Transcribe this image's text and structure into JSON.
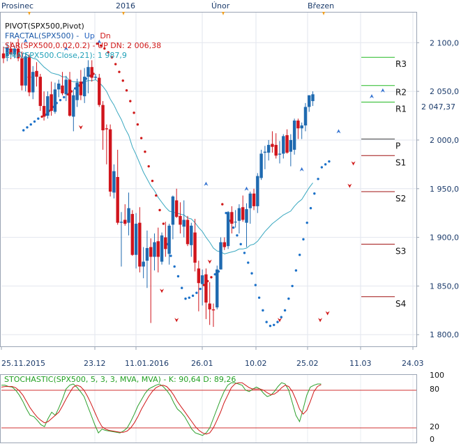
{
  "top_axis": {
    "labels": [
      "Prosinec",
      "2016",
      "Únor",
      "Březen"
    ],
    "marker_color": "#f0a020"
  },
  "legend": {
    "pivot": "PIVOT(SPX500,Pivot)",
    "fractal_prefix": "FRACTAL(SPX500) -",
    "fractal_up": "Up",
    "fractal_dn": "Dn",
    "sar": "SAR(SPX500,0.02,0.2) -  UP  DN: 2 006,38",
    "ema": "EMA(SPX500.Close,21): 1 987,9"
  },
  "price_panel": {
    "last_price_label": "2 047,37",
    "last_price": 2047.37
  },
  "stoch_legend": "STOCHASTIC(SPX500, 5, 3, 3, MVA, MVA) -  K: 90,64  D: 89,26",
  "colors": {
    "up_candle": "#1f6ab0",
    "down_candle": "#d0141c",
    "sar": "#d01818",
    "sar_up": "#1a70c8",
    "ema": "#3aa8c0",
    "stoch_k": "#2ca02c",
    "stoch_d": "#d01818",
    "resistance": "#22b822",
    "support": "#a01010",
    "pivot": "#444444",
    "fractal_up": "#3070d0",
    "fractal_dn": "#d01818"
  },
  "chart_data": [
    {
      "type": "candlestick",
      "title": "SPX500",
      "x_tick_labels": [
        "25.11.2015",
        "23.12",
        "11.01.2016",
        "26.01",
        "10.02",
        "25.02",
        "11.03",
        "24.03"
      ],
      "y_tick_labels": [
        "2 100,0",
        "2 050,0",
        "2 000,0",
        "1 950,0",
        "1 900,0",
        "1 850,0",
        "1 800,0"
      ],
      "y_ticks": [
        2100,
        2050,
        2000,
        1950,
        1900,
        1850,
        1800
      ],
      "ylim": [
        1788,
        2131
      ],
      "ohlc": [
        [
          2089,
          2096,
          2079,
          2084
        ],
        [
          2086,
          2099,
          2081,
          2095
        ],
        [
          2094,
          2101,
          2083,
          2088
        ],
        [
          2088,
          2097,
          2084,
          2094
        ],
        [
          2094,
          2104,
          2081,
          2084
        ],
        [
          2084,
          2091,
          2051,
          2056
        ],
        [
          2056,
          2090,
          2050,
          2086
        ],
        [
          2085,
          2088,
          2045,
          2049
        ],
        [
          2049,
          2076,
          2042,
          2070
        ],
        [
          2071,
          2080,
          2055,
          2065
        ],
        [
          2065,
          2068,
          2030,
          2035
        ],
        [
          2035,
          2050,
          2020,
          2024
        ],
        [
          2025,
          2050,
          2022,
          2045
        ],
        [
          2047,
          2060,
          2025,
          2030
        ],
        [
          2029,
          2059,
          2027,
          2052
        ],
        [
          2052,
          2062,
          2044,
          2058
        ],
        [
          2056,
          2070,
          2046,
          2048
        ],
        [
          2047,
          2066,
          2040,
          2062
        ],
        [
          2062,
          2070,
          2024,
          2025
        ],
        [
          2024,
          2052,
          2009,
          2046
        ],
        [
          2041,
          2063,
          2034,
          2059
        ],
        [
          2060,
          2072,
          2041,
          2046
        ],
        [
          2045,
          2074,
          2038,
          2065
        ],
        [
          2065,
          2082,
          2048,
          2075
        ],
        [
          2075,
          2082,
          2060,
          2064
        ],
        [
          2064,
          2068,
          2062,
          2065
        ],
        [
          2064,
          2068,
          2034,
          2036
        ],
        [
          2036,
          2040,
          1990,
          2010
        ],
        [
          2012,
          2016,
          1975,
          2011
        ],
        [
          2011,
          2016,
          1942,
          1947
        ],
        [
          1946,
          1975,
          1940,
          1968
        ],
        [
          1962,
          1990,
          1913,
          1915
        ],
        [
          1915,
          1926,
          1870,
          1916
        ],
        [
          1918,
          1934,
          1912,
          1914
        ],
        [
          1915,
          1946,
          1902,
          1930
        ],
        [
          1924,
          1928,
          1881,
          1882
        ],
        [
          1882,
          1925,
          1868,
          1914
        ],
        [
          1915,
          1931,
          1864,
          1870
        ],
        [
          1870,
          1890,
          1858,
          1875
        ],
        [
          1876,
          1907,
          1848,
          1889
        ],
        [
          1890,
          1899,
          1812,
          1880
        ],
        [
          1880,
          1904,
          1866,
          1895
        ],
        [
          1896,
          1910,
          1864,
          1880
        ],
        [
          1875,
          1905,
          1872,
          1902
        ],
        [
          1900,
          1916,
          1880,
          1888
        ],
        [
          1883,
          1914,
          1872,
          1912
        ],
        [
          1913,
          1943,
          1898,
          1942
        ],
        [
          1938,
          1950,
          1920,
          1921
        ],
        [
          1922,
          1936,
          1904,
          1913
        ],
        [
          1911,
          1938,
          1900,
          1918
        ],
        [
          1918,
          1922,
          1891,
          1893
        ],
        [
          1892,
          1915,
          1880,
          1912
        ],
        [
          1905,
          1919,
          1865,
          1874
        ],
        [
          1868,
          1876,
          1824,
          1853
        ],
        [
          1852,
          1867,
          1830,
          1861
        ],
        [
          1862,
          1868,
          1816,
          1833
        ],
        [
          1832,
          1854,
          1810,
          1826
        ],
        [
          1826,
          1832,
          1808,
          1825
        ],
        [
          1828,
          1871,
          1826,
          1867
        ],
        [
          1867,
          1900,
          1867,
          1895
        ],
        [
          1895,
          1900,
          1887,
          1890
        ],
        [
          1891,
          1927,
          1888,
          1926
        ],
        [
          1926,
          1932,
          1904,
          1914
        ],
        [
          1916,
          1928,
          1910,
          1916
        ],
        [
          1917,
          1934,
          1904,
          1930
        ],
        [
          1931,
          1943,
          1916,
          1918
        ],
        [
          1915,
          1935,
          1890,
          1929
        ],
        [
          1930,
          1947,
          1914,
          1945
        ],
        [
          1945,
          1950,
          1928,
          1932
        ],
        [
          1932,
          1966,
          1925,
          1963
        ],
        [
          1961,
          1990,
          1959,
          1986
        ],
        [
          1987,
          1994,
          1970,
          1988
        ],
        [
          1987,
          2000,
          1979,
          1995
        ],
        [
          1996,
          2009,
          1987,
          1993
        ],
        [
          1995,
          2007,
          1981,
          1984
        ],
        [
          1985,
          1999,
          1976,
          1986
        ],
        [
          1986,
          2006,
          1981,
          2004
        ],
        [
          2005,
          2011,
          1986,
          1987
        ],
        [
          1988,
          2006,
          1973,
          2000
        ],
        [
          1990,
          2022,
          1985,
          2020
        ],
        [
          2020,
          2022,
          2001,
          2012
        ],
        [
          2012,
          2018,
          2001,
          2015
        ],
        [
          2015,
          2038,
          2009,
          2034
        ],
        [
          2034,
          2046,
          2029,
          2046
        ],
        [
          2040,
          2050,
          2035,
          2047
        ]
      ],
      "ema_21": [
        2095,
        2094,
        2093,
        2093,
        2092,
        2089,
        2089,
        2086,
        2084,
        2083,
        2079,
        2075,
        2072,
        2069,
        2068,
        2067,
        2065,
        2065,
        2061,
        2060,
        2060,
        2059,
        2060,
        2061,
        2061,
        2062,
        2059,
        2055,
        2050,
        2042,
        2036,
        2028,
        2021,
        2012,
        2005,
        1993,
        1985,
        1976,
        1967,
        1960,
        1953,
        1948,
        1941,
        1936,
        1931,
        1927,
        1926,
        1925,
        1924,
        1923,
        1920,
        1919,
        1915,
        1910,
        1906,
        1900,
        1895,
        1889,
        1886,
        1885,
        1883,
        1884,
        1885,
        1886,
        1888,
        1888,
        1889,
        1892,
        1893,
        1896,
        1901,
        1906,
        1910,
        1914,
        1917,
        1920,
        1923,
        1925,
        1927,
        1932,
        1936,
        1939,
        1945,
        1951,
        1956
      ],
      "sar": [
        null,
        null,
        null,
        null,
        null,
        null,
        2010,
        2013,
        2016,
        2019,
        2022,
        2024,
        2026,
        2030,
        2034,
        2038,
        2041,
        2044,
        2047,
        2050,
        2053,
        2056,
        2059,
        2063,
        2066,
        2068,
        2099,
        2097,
        2094,
        2090,
        2085,
        2078,
        2070,
        2061,
        2051,
        2040,
        2028,
        2016,
        2002,
        1988,
        1973,
        1958,
        1943,
        1928,
        1914,
        1893,
        1881,
        1870,
        1860,
        1848,
        1837,
        1838,
        1840,
        1843,
        1847,
        1851,
        1855,
        1859,
        1862,
        1865,
        1934,
        1925,
        1917,
        1910,
        1902,
        1893,
        1884,
        1874,
        1863,
        1851,
        1838,
        1825,
        1813,
        1809,
        1810,
        1813,
        1818,
        1825,
        1837,
        1850,
        1866,
        1882,
        1898,
        1915,
        1930,
        1945,
        1960,
        1972,
        1975,
        1978
      ],
      "fractals_up": [
        [
          6,
          2102
        ],
        [
          17,
          2094
        ],
        [
          26,
          2101
        ],
        [
          55,
          1955
        ],
        [
          66,
          1950
        ],
        [
          81,
          1970
        ],
        [
          91,
          2009
        ],
        [
          100,
          2045
        ],
        [
          103,
          2051
        ]
      ],
      "fractals_down": [
        [
          7,
          2063
        ],
        [
          21,
          2013
        ],
        [
          43,
          1845
        ],
        [
          47,
          1815
        ],
        [
          56,
          1875
        ],
        [
          75,
          1815
        ],
        [
          86,
          1815
        ],
        [
          88,
          1822
        ],
        [
          94,
          1953
        ],
        [
          95,
          1976
        ]
      ],
      "pivot_levels": [
        {
          "label": "R3",
          "value": 2085
        },
        {
          "label": "R2",
          "value": 2056
        },
        {
          "label": "R1",
          "value": 2039
        },
        {
          "label": "P",
          "value": 2001
        },
        {
          "label": "S1",
          "value": 1984
        },
        {
          "label": "S2",
          "value": 1947
        },
        {
          "label": "S3",
          "value": 1893
        },
        {
          "label": "S4",
          "value": 1839
        }
      ]
    },
    {
      "type": "line",
      "title": "STOCHASTIC(SPX500, 5, 3, 3, MVA, MVA)",
      "y_tick_labels": [
        "100",
        "80",
        "20",
        "0"
      ],
      "ylim": [
        0,
        100
      ],
      "reference_lines": [
        80,
        20
      ],
      "series": [
        {
          "name": "K",
          "values": [
            88,
            88,
            86,
            85,
            80,
            72,
            62,
            50,
            40,
            38,
            32,
            25,
            22,
            35,
            45,
            40,
            52,
            66,
            82,
            88,
            90,
            85,
            78,
            70,
            55,
            40,
            25,
            12,
            18,
            16,
            15,
            14,
            13,
            12,
            15,
            20,
            30,
            42,
            55,
            65,
            75,
            82,
            85,
            88,
            90,
            86,
            80,
            72,
            60,
            50,
            45,
            38,
            28,
            18,
            12,
            10,
            8,
            12,
            20,
            35,
            50,
            65,
            78,
            88,
            92,
            92,
            90,
            88,
            80,
            78,
            82,
            85,
            82,
            75,
            70,
            72,
            78,
            86,
            92,
            90,
            80,
            60,
            40,
            30,
            50,
            72,
            85,
            88,
            90,
            90
          ]
        },
        {
          "name": "D",
          "values": [
            85,
            86,
            86,
            86,
            84,
            79,
            72,
            62,
            52,
            44,
            37,
            32,
            28,
            30,
            35,
            40,
            45,
            55,
            66,
            76,
            85,
            88,
            86,
            80,
            70,
            58,
            45,
            32,
            22,
            18,
            16,
            15,
            14,
            13,
            13,
            15,
            20,
            28,
            38,
            50,
            60,
            70,
            78,
            84,
            87,
            88,
            86,
            80,
            72,
            62,
            54,
            46,
            38,
            30,
            22,
            16,
            12,
            10,
            12,
            20,
            32,
            45,
            60,
            72,
            84,
            90,
            92,
            92,
            88,
            84,
            82,
            82,
            82,
            80,
            76,
            73,
            74,
            78,
            84,
            88,
            86,
            78,
            65,
            50,
            42,
            48,
            62,
            78,
            86,
            89
          ]
        }
      ]
    }
  ]
}
